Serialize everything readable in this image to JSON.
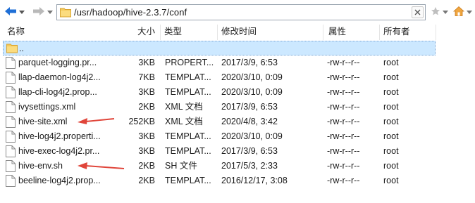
{
  "address": {
    "path": "/usr/hadoop/hive-2.3.7/conf"
  },
  "columns": {
    "name": "名称",
    "size": "大小",
    "type": "类型",
    "modified": "修改时间",
    "attributes": "属性",
    "owner": "所有者"
  },
  "parent_row": {
    "name": ".."
  },
  "files": [
    {
      "name": "parquet-logging.pr...",
      "size": "3KB",
      "type": "PROPERT...",
      "modified": "2017/3/9, 6:53",
      "attributes": "-rw-r--r--",
      "owner": "root"
    },
    {
      "name": "llap-daemon-log4j2...",
      "size": "7KB",
      "type": "TEMPLAT...",
      "modified": "2020/3/10, 0:09",
      "attributes": "-rw-r--r--",
      "owner": "root"
    },
    {
      "name": "llap-cli-log4j2.prop...",
      "size": "3KB",
      "type": "TEMPLAT...",
      "modified": "2020/3/10, 0:09",
      "attributes": "-rw-r--r--",
      "owner": "root"
    },
    {
      "name": "ivysettings.xml",
      "size": "2KB",
      "type": "XML 文档",
      "modified": "2017/3/9, 6:53",
      "attributes": "-rw-r--r--",
      "owner": "root"
    },
    {
      "name": "hive-site.xml",
      "size": "252KB",
      "type": "XML 文档",
      "modified": "2020/4/8, 3:42",
      "attributes": "-rw-r--r--",
      "owner": "root"
    },
    {
      "name": "hive-log4j2.properti...",
      "size": "3KB",
      "type": "TEMPLAT...",
      "modified": "2020/3/10, 0:09",
      "attributes": "-rw-r--r--",
      "owner": "root"
    },
    {
      "name": "hive-exec-log4j2.pr...",
      "size": "3KB",
      "type": "TEMPLAT...",
      "modified": "2017/3/9, 6:53",
      "attributes": "-rw-r--r--",
      "owner": "root"
    },
    {
      "name": "hive-env.sh",
      "size": "2KB",
      "type": "SH 文件",
      "modified": "2017/5/3, 2:33",
      "attributes": "-rw-r--r--",
      "owner": "root"
    },
    {
      "name": "beeline-log4j2.prop...",
      "size": "2KB",
      "type": "TEMPLAT...",
      "modified": "2016/12/17, 3:08",
      "attributes": "-rw-r--r--",
      "owner": "root"
    }
  ],
  "icons": {
    "back": "arrow-left-icon",
    "forward": "arrow-right-icon",
    "folder": "folder-icon",
    "file": "file-icon",
    "clear": "close-icon",
    "bookmark": "star-icon",
    "home": "home-icon"
  },
  "colors": {
    "selection": "#cce8ff",
    "annotation_arrow": "#e0453a",
    "nav_arrow": "#1f6fd6",
    "folder": "#f4c95d"
  }
}
